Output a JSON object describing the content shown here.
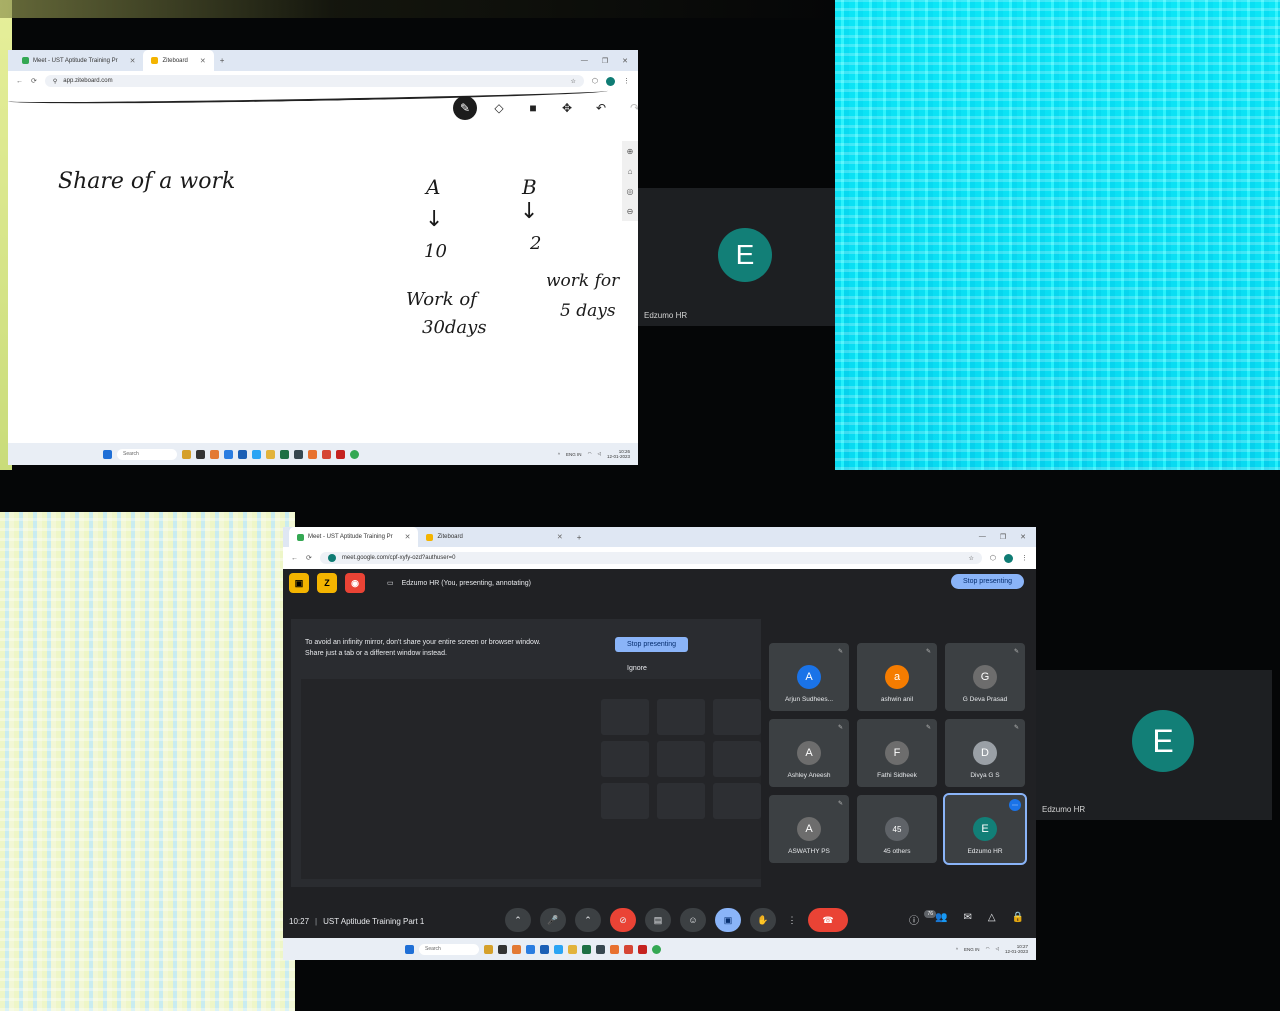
{
  "whiteboard_window": {
    "tabs": [
      {
        "label": "Meet - UST Aptitude Training Pr",
        "fav": "#34a853"
      },
      {
        "label": "Ziteboard",
        "fav": "#f4b400"
      }
    ],
    "new_tab": "+",
    "url": "app.ziteboard.com",
    "tools": [
      "pen-icon",
      "eraser-icon",
      "shape-icon",
      "move-icon",
      "undo-icon",
      "redo-icon"
    ],
    "board": {
      "title": "Share  of  a  work",
      "col_a_label": "A",
      "col_a_value": "10",
      "col_a_note_line1": "Work of",
      "col_a_note_line2": "30days",
      "col_b_label": "B",
      "col_b_value": "2",
      "col_b_note_line1": "work for",
      "col_b_note_line2": "5 days",
      "arrow": "↓"
    },
    "taskbar": {
      "search": "Search",
      "lang": "ENG IN",
      "time": "10:26",
      "date": "12-01-2023"
    }
  },
  "self_view_top": {
    "initial": "E",
    "name": "Edzumo HR"
  },
  "self_view_bottom": {
    "initial": "E",
    "name": "Edzumo HR"
  },
  "meet_window": {
    "tabs": [
      {
        "label": "Meet - UST Aptitude Training Pr",
        "fav": "#34a853"
      },
      {
        "label": "Ziteboard",
        "fav": "#f4b400"
      }
    ],
    "new_tab": "+",
    "url": "meet.google.com/cpf-xyfy-ozd?authuser=0",
    "presenting_text": "Edzumo HR (You, presenting, annotating)",
    "stop_presenting": "Stop presenting",
    "mirror_warning_line1": "To avoid an infinity mirror, don't share your entire screen or browser window.",
    "mirror_warning_line2": "Share just a tab or a different window instead.",
    "mirror_stop": "Stop presenting",
    "mirror_ignore": "Ignore",
    "participants": [
      {
        "name": "Arjun Sudhees...",
        "initial": "A",
        "color": "#1a73e8"
      },
      {
        "name": "ashwin anil",
        "initial": "a",
        "color": "#f57c00"
      },
      {
        "name": "G Deva Prasad",
        "initial": "G",
        "color": "#6d6d6d"
      },
      {
        "name": "Ashley Aneesh",
        "initial": "A",
        "color": "#6d6d6d"
      },
      {
        "name": "Fathi Sidheek",
        "initial": "F",
        "color": "#6d6d6d"
      },
      {
        "name": "Divya G S",
        "initial": "D",
        "color": "#9aa0a6"
      },
      {
        "name": "ASWATHY PS",
        "initial": "A",
        "color": "#6d6d6d"
      },
      {
        "name": "45 others",
        "initial": "45",
        "color": "#5f6368"
      },
      {
        "name": "Edzumo HR",
        "initial": "E",
        "color": "#127f77"
      }
    ],
    "clock": "10:27",
    "meeting_name": "UST Aptitude Training Part 1",
    "people_count": "76",
    "taskbar": {
      "search": "Search",
      "lang": "ENG IN",
      "time": "10:27",
      "date": "12-01-2023"
    }
  },
  "colors": {
    "accent": "#8ab4f8",
    "avatar": "#127f77",
    "end_call": "#ea4335"
  }
}
